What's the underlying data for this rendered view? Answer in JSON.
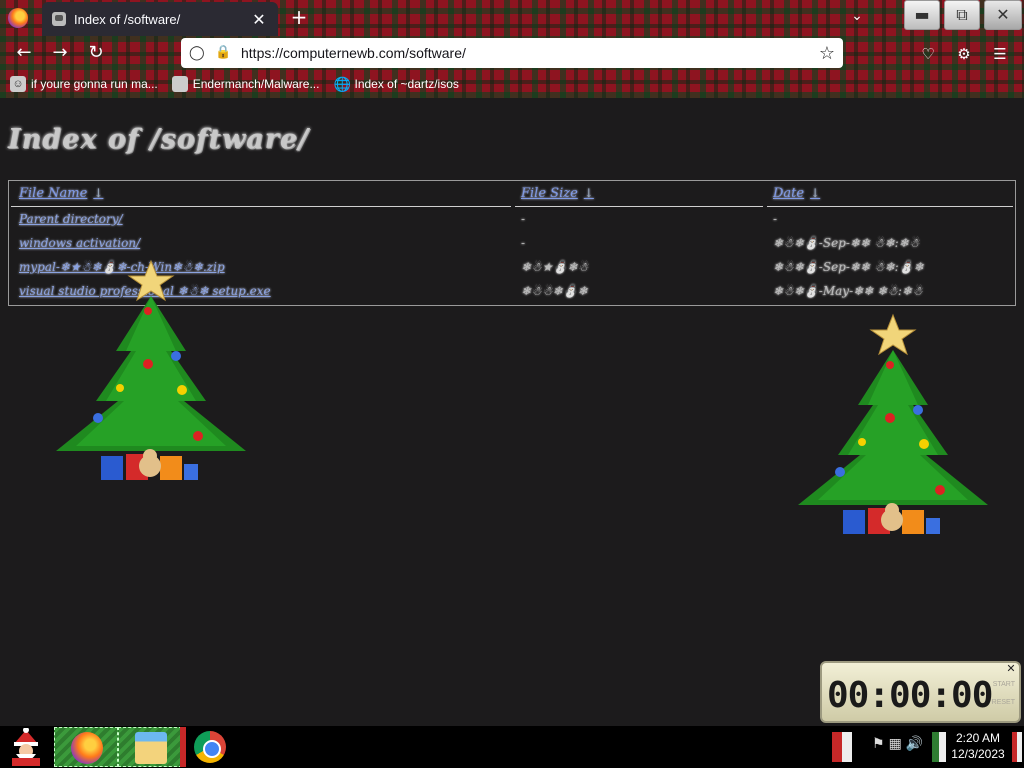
{
  "browser": {
    "tab_title": "Index of /software/",
    "tab_close": "✕",
    "new_tab": "+",
    "url": "https://computernewb.com/software/",
    "bookmarks": [
      {
        "label": "if youre gonna run ma...",
        "icon": "user-icon"
      },
      {
        "label": "Endermanch/Malware...",
        "icon": "page-icon"
      },
      {
        "label": "Index of ~dartz/isos",
        "icon": "globe-icon"
      }
    ]
  },
  "page": {
    "title": "Index of /software/",
    "columns": {
      "name": "File Name",
      "size": "File Size",
      "date": "Date",
      "sort_icon": "↓"
    },
    "rows": [
      {
        "name": "Parent directory/",
        "size": "-",
        "date": "-"
      },
      {
        "name": "windows activation/",
        "size": "-",
        "date": "❄☃❄⛄-Sep-❄❄ ☃❄:❄☃"
      },
      {
        "name": "mypal-❄★☃❄⛄❄-ch-Win❄☃❄.zip",
        "size": "❄☃★⛄❄☃",
        "date": "❄☃❄⛄-Sep-❄❄ ☃❄:⛄❄"
      },
      {
        "name": "visual studio professional ❄☃❄ setup.exe",
        "size": "❄☃☃❄⛄❄",
        "date": "❄☃❄⛄-May-❄❄ ❄☃:❄☃"
      }
    ]
  },
  "timer": {
    "display": "00:00:00",
    "start": "START",
    "reset": "RESET",
    "close": "✕"
  },
  "taskbar": {
    "time": "2:20 AM",
    "date": "12/3/2023"
  },
  "colors": {
    "link": "#8aa2e0",
    "page_bg": "#1c1b1c",
    "chrome_plaid": "#8e1420"
  }
}
